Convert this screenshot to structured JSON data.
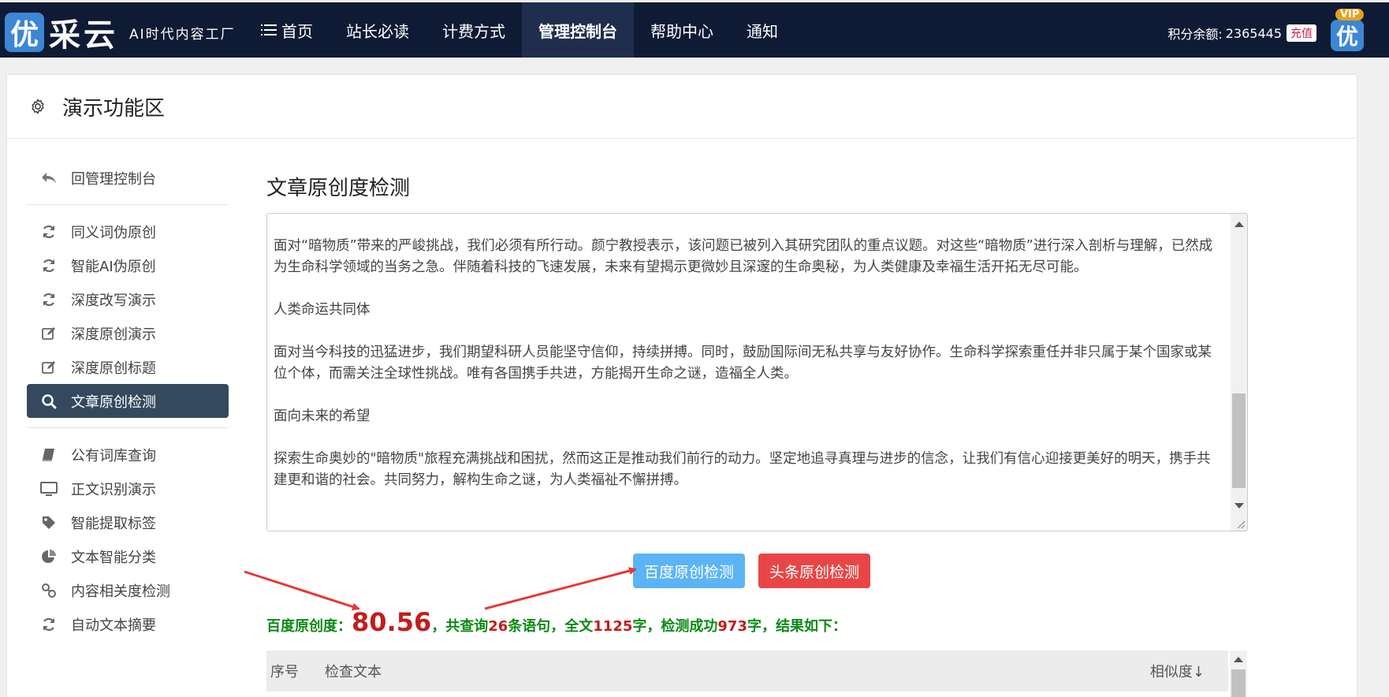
{
  "header": {
    "logo_char": "优",
    "logo_text": "采云",
    "slogan": "AI时代内容工厂",
    "nav": [
      {
        "label": "首页",
        "active": false
      },
      {
        "label": "站长必读",
        "active": false
      },
      {
        "label": "计费方式",
        "active": false
      },
      {
        "label": "管理控制台",
        "active": true
      },
      {
        "label": "帮助中心",
        "active": false
      },
      {
        "label": "通知",
        "active": false
      }
    ],
    "balance_label": "积分余额:",
    "balance_value": "2365445",
    "recharge_label": "充值",
    "avatar_char": "优",
    "vip_badge": "VIP"
  },
  "panel": {
    "title": "演示功能区"
  },
  "sidebar": {
    "back_label": "回管理控制台",
    "group1": [
      {
        "label": "同义词伪原创",
        "icon": "refresh-icon"
      },
      {
        "label": "智能AI伪原创",
        "icon": "refresh-icon"
      },
      {
        "label": "深度改写演示",
        "icon": "refresh-icon"
      },
      {
        "label": "深度原创演示",
        "icon": "edit-icon"
      },
      {
        "label": "深度原创标题",
        "icon": "edit-icon"
      },
      {
        "label": "文章原创检测",
        "icon": "search-icon",
        "active": true
      }
    ],
    "group2": [
      {
        "label": "公有词库查询",
        "icon": "book-icon"
      },
      {
        "label": "正文识别演示",
        "icon": "monitor-icon"
      },
      {
        "label": "智能提取标签",
        "icon": "tag-icon"
      },
      {
        "label": "文本智能分类",
        "icon": "pie-chart-icon"
      },
      {
        "label": "内容相关度检测",
        "icon": "link-icon"
      },
      {
        "label": "自动文本摘要",
        "icon": "refresh-icon"
      }
    ]
  },
  "main": {
    "title": "文章原创度检测",
    "paragraphs": [
      "面对“暗物质”带来的严峻挑战，我们必须有所行动。颜宁教授表示，该问题已被列入其研究团队的重点议题。对这些“暗物质”进行深入剖析与理解，已然成为生命科学领域的当务之急。伴随着科技的飞速发展，未来有望揭示更微妙且深邃的生命奥秘，为人类健康及幸福生活开拓无尽可能。",
      "人类命运共同体",
      "面对当今科技的迅猛进步，我们期望科研人员能坚守信仰，持续拼搏。同时，鼓励国际间无私共享与友好协作。生命科学探索重任并非只属于某个国家或某位个体，而需关注全球性挑战。唯有各国携手共进，方能揭开生命之谜，造福全人类。",
      "面向未来的希望",
      "探索生命奥妙的\"暗物质\"旅程充满挑战和困扰，然而这正是推动我们前行的动力。坚定地追寻真理与进步的信念，让我们有信心迎接更美好的明天，携手共建更和谐的社会。共同努力，解构生命之谜，为人类福祉不懈拼搏。"
    ],
    "btn_baidu": "百度原创检测",
    "btn_toutiao": "头条原创检测",
    "result": {
      "label": "百度原创度：",
      "score": "80.56",
      "sep1": "，共查询",
      "sentences": "26",
      "sep2": "条语句，全文",
      "chars_total": "1125",
      "sep3": "字，检测成功",
      "chars_ok": "973",
      "sep4": "字，结果如下："
    },
    "table": {
      "col_no": "序号",
      "col_text": "检查文本",
      "col_sim": "相似度↓"
    }
  },
  "colors": {
    "nav_bg": "#0f1b34",
    "active_side": "#34495e",
    "btn_baidu": "#5bb4f5",
    "btn_toutiao": "#e84646",
    "result_green": "#0d8a17",
    "result_red": "#c31c1c"
  }
}
